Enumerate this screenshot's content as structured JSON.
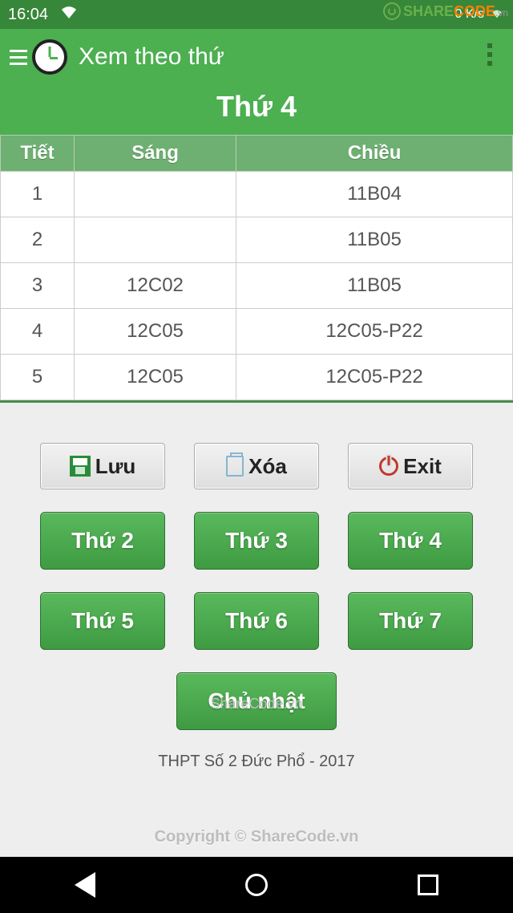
{
  "status": {
    "time": "16:04",
    "net_speed": "0 K/s"
  },
  "logo": {
    "part1": "SHARE",
    "part2": "CODE",
    "part3": ".vn"
  },
  "appbar": {
    "title": "Xem theo thứ"
  },
  "heading": "Thứ 4",
  "table": {
    "headers": [
      "Tiết",
      "Sáng",
      "Chiều"
    ],
    "rows": [
      {
        "tiet": "1",
        "sang": "",
        "chieu": "11B04"
      },
      {
        "tiet": "2",
        "sang": "",
        "chieu": "11B05"
      },
      {
        "tiet": "3",
        "sang": "12C02",
        "chieu": "11B05"
      },
      {
        "tiet": "4",
        "sang": "12C05",
        "chieu": "12C05-P22"
      },
      {
        "tiet": "5",
        "sang": "12C05",
        "chieu": "12C05-P22"
      }
    ]
  },
  "actions": {
    "save": "Lưu",
    "delete": "Xóa",
    "exit": "Exit"
  },
  "days": {
    "d2": "Thứ 2",
    "d3": "Thứ 3",
    "d4": "Thứ 4",
    "d5": "Thứ 5",
    "d6": "Thứ 6",
    "d7": "Thứ 7",
    "cn": "Chủ nhật"
  },
  "footer": "THPT Số 2 Đức Phổ - 2017",
  "watermark1": "ShareCode.vn",
  "watermark2": "Copyright © ShareCode.vn"
}
